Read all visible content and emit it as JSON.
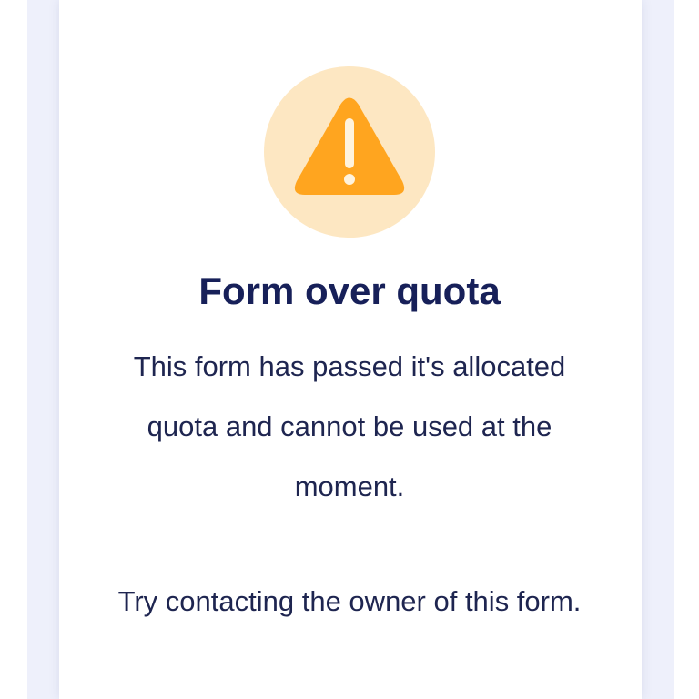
{
  "colors": {
    "background_panel": "#eef0fb",
    "card": "#ffffff",
    "warning_circle": "#fde7c2",
    "warning_triangle": "#ffa51f",
    "title": "#172059",
    "body_text": "#1e2550"
  },
  "icon": {
    "name": "warning-icon"
  },
  "notice": {
    "title": "Form over quota",
    "message": "This form has passed it's allocated quota and cannot be used at the moment.",
    "hint": "Try contacting the owner of this form."
  }
}
